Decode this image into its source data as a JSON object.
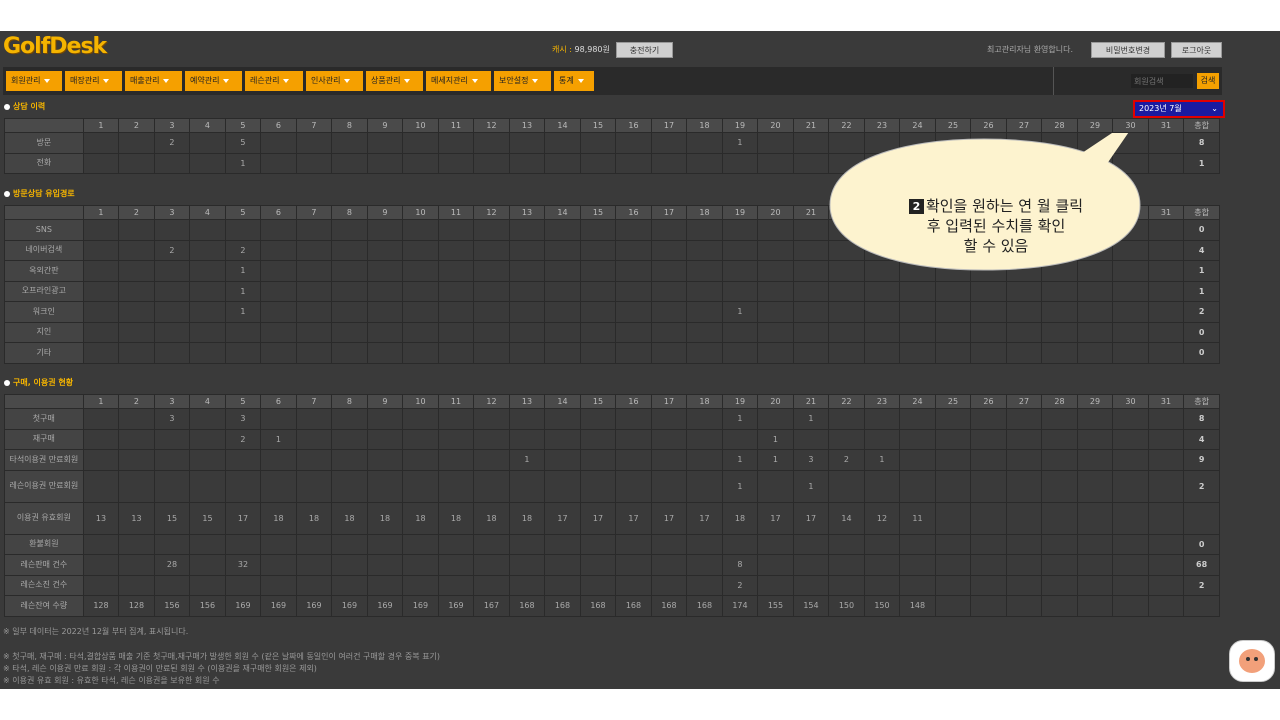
{
  "header": {
    "logo_text": "GolfDesk",
    "cash_label": "캐시 :",
    "cash_value": "98,980원",
    "recharge_button": "충전하기",
    "welcome": "최고관리자님 환영합니다.",
    "change_password_button": "비밀번호변경",
    "logout_button": "로그아웃"
  },
  "nav": {
    "items": [
      "회원관리",
      "매장관리",
      "매출관리",
      "예약관리",
      "레슨관리",
      "인사관리",
      "상품관리",
      "메세지관리",
      "보안설정",
      "통계"
    ],
    "search_placeholder": "회원검색",
    "search_button": "검색"
  },
  "month_select": {
    "value": "2023년 7월"
  },
  "days": [
    "1",
    "2",
    "3",
    "4",
    "5",
    "6",
    "7",
    "8",
    "9",
    "10",
    "11",
    "12",
    "13",
    "14",
    "15",
    "16",
    "17",
    "18",
    "19",
    "20",
    "21",
    "22",
    "23",
    "24",
    "25",
    "26",
    "27",
    "28",
    "29",
    "30",
    "31"
  ],
  "total_label": "총합",
  "sections": [
    {
      "title": "상담 이력",
      "rows": [
        {
          "label": "방문",
          "cells": {
            "3": "2",
            "5": "5",
            "19": "1"
          },
          "total": "8"
        },
        {
          "label": "전화",
          "cells": {
            "5": "1"
          },
          "total": "1"
        }
      ]
    },
    {
      "title": "방문상담 유입경로",
      "rows": [
        {
          "label": "SNS",
          "cells": {},
          "total": "0"
        },
        {
          "label": "네이버검색",
          "cells": {
            "3": "2",
            "5": "2"
          },
          "total": "4"
        },
        {
          "label": "옥외간판",
          "cells": {
            "5": "1"
          },
          "total": "1"
        },
        {
          "label": "오프라인광고",
          "cells": {
            "5": "1"
          },
          "total": "1"
        },
        {
          "label": "워크인",
          "cells": {
            "5": "1",
            "19": "1"
          },
          "total": "2"
        },
        {
          "label": "지인",
          "cells": {},
          "total": "0"
        },
        {
          "label": "기타",
          "cells": {},
          "total": "0"
        }
      ]
    },
    {
      "title": "구매, 이용권 현황",
      "rows": [
        {
          "label": "첫구매",
          "cells": {
            "3": "3",
            "5": "3",
            "19": "1",
            "21": "1"
          },
          "total": "8"
        },
        {
          "label": "재구매",
          "cells": {
            "5": "2",
            "6": "1",
            "20": "1"
          },
          "total": "4"
        },
        {
          "label": "타석이용권 만료회원",
          "cells": {
            "13": "1",
            "19": "1",
            "20": "1",
            "21": "3",
            "22": "2",
            "23": "1"
          },
          "total": "9"
        },
        {
          "label": "레슨이용권 만료회원",
          "cells": {
            "19": "1",
            "21": "1"
          },
          "total": "2"
        },
        {
          "label": "이용권 유효회원",
          "cells": {
            "1": "13",
            "2": "13",
            "3": "15",
            "4": "15",
            "5": "17",
            "6": "18",
            "7": "18",
            "8": "18",
            "9": "18",
            "10": "18",
            "11": "18",
            "12": "18",
            "13": "18",
            "14": "17",
            "15": "17",
            "16": "17",
            "17": "17",
            "18": "17",
            "19": "18",
            "20": "17",
            "21": "17",
            "22": "14",
            "23": "12",
            "24": "11"
          },
          "total": ""
        },
        {
          "label": "환불회원",
          "cells": {},
          "total": "0"
        },
        {
          "label": "레슨판매 건수",
          "cells": {
            "3": "28",
            "5": "32",
            "19": "8"
          },
          "total": "68"
        },
        {
          "label": "레슨소진 건수",
          "cells": {
            "19": "2"
          },
          "total": "2"
        },
        {
          "label": "레슨잔여 수량",
          "cells": {
            "1": "128",
            "2": "128",
            "3": "156",
            "4": "156",
            "5": "169",
            "6": "169",
            "7": "169",
            "8": "169",
            "9": "169",
            "10": "169",
            "11": "169",
            "12": "167",
            "13": "168",
            "14": "168",
            "15": "168",
            "16": "168",
            "17": "168",
            "18": "168",
            "19": "174",
            "20": "155",
            "21": "154",
            "22": "150",
            "23": "150",
            "24": "148"
          },
          "total": ""
        }
      ]
    }
  ],
  "footnotes": [
    "※ 일부 데이터는 2022년 12월 부터 집계, 표시됩니다.",
    "※ 첫구매, 재구매 : 타석,결합상품 매출 기준 첫구매,재구매가 발생한 회원 수 (같은 날짜에 동일인이 여러건 구매할 경우 중복 표기)",
    "※ 타석, 레슨 이용권 만료 회원 : 각 이용권이 만료된 회원 수 (이용권을 재구매한 회원은 제외)",
    "※ 이용권 유효 회원 : 유효한 타석, 레슨 이용권을 보유한 회원 수"
  ],
  "callout": {
    "number": "2",
    "line1": "확인을 원하는 연 월 클릭",
    "line2": "후 입력된 수치를 확인",
    "line3": "할 수 있음"
  },
  "colors": {
    "accent": "#f5a000",
    "highlight_border": "#e00000",
    "select_bg": "#1a1aa0",
    "callout_bg": "#fdf3cf"
  }
}
